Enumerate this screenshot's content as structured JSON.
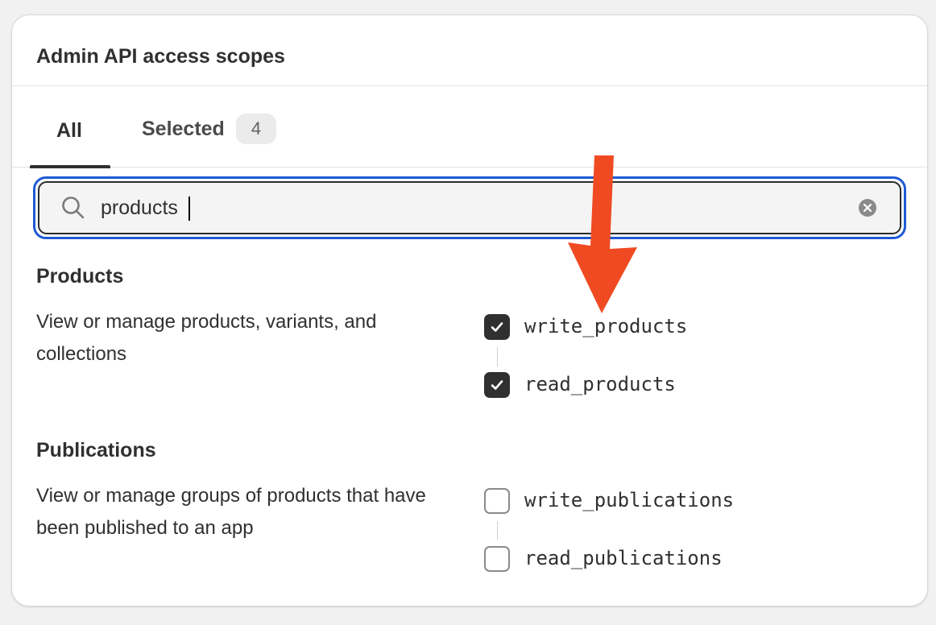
{
  "card": {
    "title": "Admin API access scopes"
  },
  "tabs": [
    {
      "label": "All",
      "active": true
    },
    {
      "label": "Selected",
      "badge": "4",
      "active": false
    }
  ],
  "search": {
    "value": "products",
    "search_icon": "search-icon",
    "clear_icon": "clear-icon"
  },
  "sections": [
    {
      "title": "Products",
      "description": "View or manage products, variants, and collections",
      "scopes": [
        {
          "label": "write_products",
          "checked": true
        },
        {
          "label": "read_products",
          "checked": true
        }
      ]
    },
    {
      "title": "Publications",
      "description": "View or manage groups of products that have been published to an app",
      "scopes": [
        {
          "label": "write_publications",
          "checked": false
        },
        {
          "label": "read_publications",
          "checked": false
        }
      ]
    }
  ],
  "annotation": {
    "icon": "red-arrow-icon",
    "color": "#f04a23"
  },
  "colors": {
    "focus_ring": "#1f5ad4",
    "checked": "#303030",
    "card_bg": "#ffffff",
    "page_bg": "#f1f1f1"
  }
}
